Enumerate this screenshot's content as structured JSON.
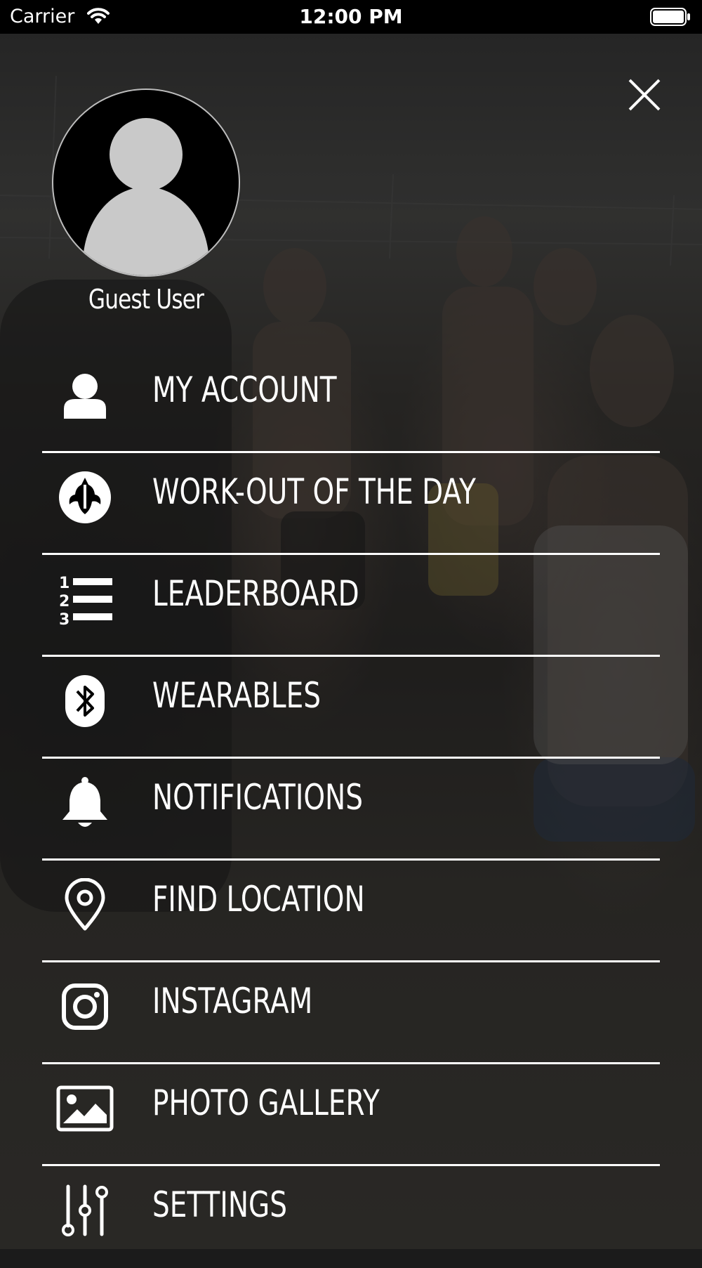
{
  "status_bar": {
    "carrier": "Carrier",
    "time": "12:00 PM"
  },
  "profile": {
    "name": "Guest User"
  },
  "menu": [
    {
      "label": "MY ACCOUNT",
      "icon": "user-icon"
    },
    {
      "label": "WORK-OUT OF THE DAY",
      "icon": "rebel-emblem-icon"
    },
    {
      "label": "LEADERBOARD",
      "icon": "numbered-list-icon"
    },
    {
      "label": "WEARABLES",
      "icon": "bluetooth-icon"
    },
    {
      "label": "NOTIFICATIONS",
      "icon": "bell-icon"
    },
    {
      "label": "FIND LOCATION",
      "icon": "map-pin-icon"
    },
    {
      "label": "INSTAGRAM",
      "icon": "instagram-icon"
    },
    {
      "label": "PHOTO GALLERY",
      "icon": "image-icon"
    },
    {
      "label": "SETTINGS",
      "icon": "sliders-icon"
    }
  ]
}
